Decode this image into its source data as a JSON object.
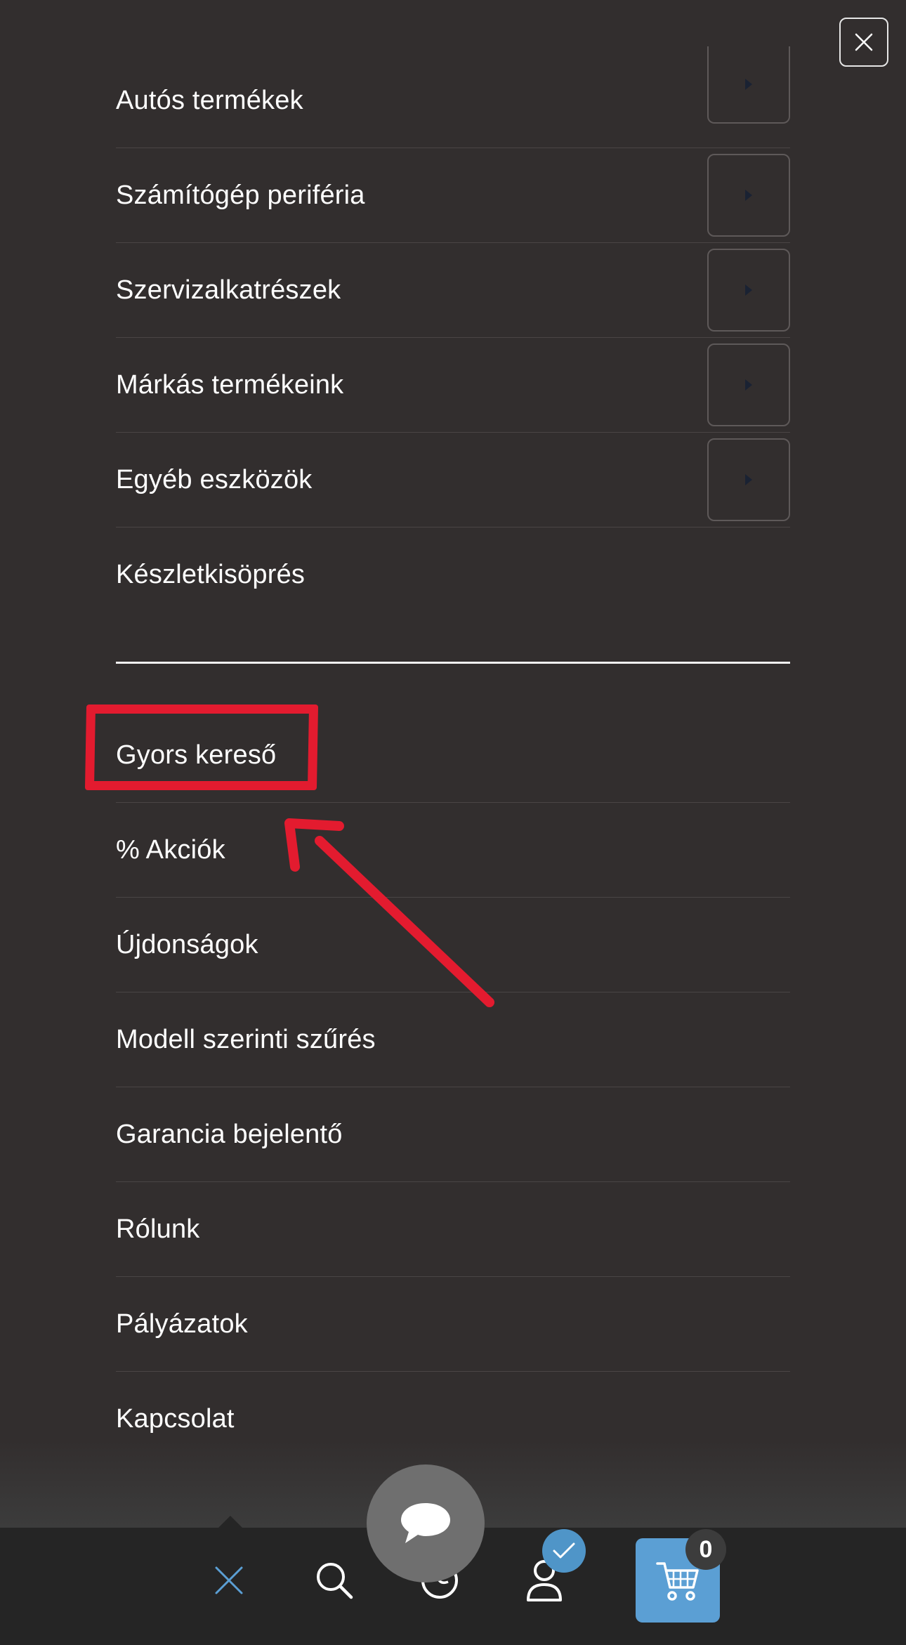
{
  "menu": {
    "categories": [
      {
        "label": "Autós termékek"
      },
      {
        "label": "Számítógép periféria"
      },
      {
        "label": "Szervizalkatrészek"
      },
      {
        "label": "Márkás termékeink"
      },
      {
        "label": "Egyéb eszközök"
      },
      {
        "label": "Készletkisöprés"
      }
    ],
    "links": [
      {
        "label": "Gyors kereső"
      },
      {
        "label": "% Akciók"
      },
      {
        "label": "Újdonságok"
      },
      {
        "label": "Modell szerinti szűrés"
      },
      {
        "label": "Garancia bejelentő"
      },
      {
        "label": "Rólunk"
      },
      {
        "label": "Pályázatok"
      },
      {
        "label": "Kapcsolat"
      }
    ]
  },
  "bottom_nav": {
    "cart_count": "0",
    "icons": [
      "close-icon",
      "search-icon",
      "globe-icon",
      "user-icon",
      "cart-icon"
    ]
  },
  "colors": {
    "background": "#322e2e",
    "annotation": "#e31b2f",
    "accent": "#5b9fd4",
    "bar": "#252525"
  }
}
